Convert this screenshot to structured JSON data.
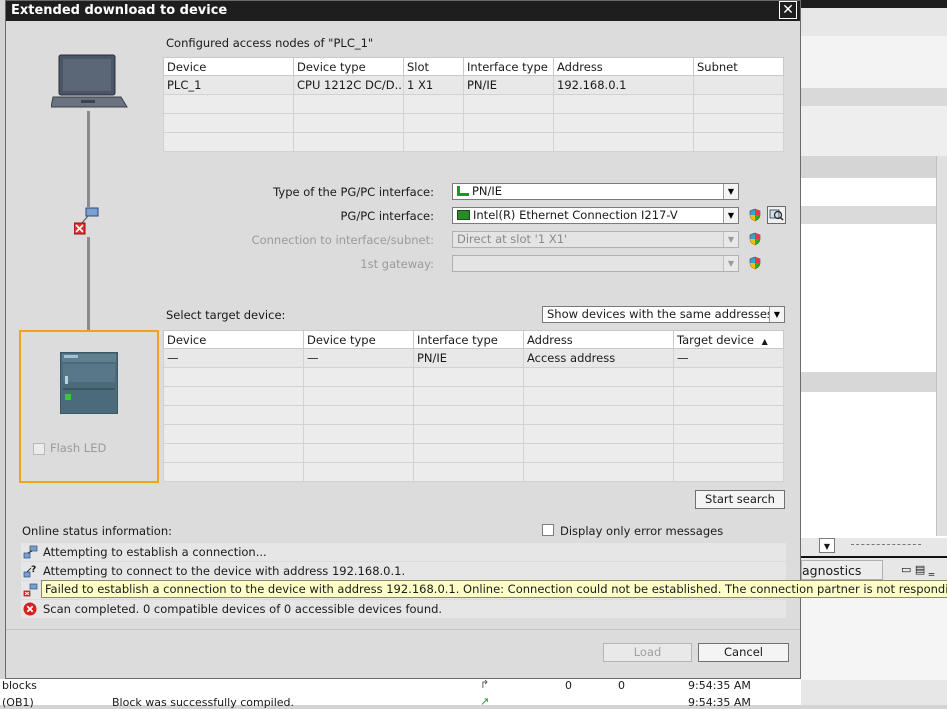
{
  "dialog": {
    "title": "Extended download to device",
    "close_glyph": "✕"
  },
  "configured": {
    "heading": "Configured access nodes of \"PLC_1\"",
    "columns": [
      "Device",
      "Device type",
      "Slot",
      "Interface type",
      "Address",
      "Subnet"
    ],
    "rows": [
      [
        "PLC_1",
        "CPU 1212C DC/D...",
        "1 X1",
        "PN/IE",
        "192.168.0.1",
        ""
      ]
    ]
  },
  "interface": {
    "type_label": "Type of the PG/PC interface:",
    "type_value": "PN/IE",
    "pgpc_label": "PG/PC interface:",
    "pgpc_value": "Intel(R) Ethernet Connection I217-V",
    "subnet_label": "Connection to interface/subnet:",
    "subnet_value": "Direct at slot '1 X1'",
    "gateway_label": "1st gateway:",
    "gateway_value": ""
  },
  "target": {
    "heading": "Select target device:",
    "filter_value": "Show devices with the same addresses",
    "columns": [
      "Device",
      "Device type",
      "Interface type",
      "Address",
      "Target device"
    ],
    "rows": [
      [
        "—",
        "—",
        "PN/IE",
        "Access address",
        "—"
      ]
    ],
    "sort_glyph": "▲"
  },
  "left_panel": {
    "flash_led_label": "Flash LED"
  },
  "buttons": {
    "start_search": "Start search",
    "load": "Load",
    "cancel": "Cancel"
  },
  "status": {
    "heading": "Online status information:",
    "error_only_label": "Display only error messages",
    "messages": [
      "Attempting to establish a connection...",
      "Attempting to connect to the device with address 192.168.0.1.",
      "Failed to establish a connection to the device with address 192.168.0.1. Online: Connection could not be established. The connection partner is not responding.",
      "Scan completed. 0 compatible devices of 0 accessible devices found."
    ]
  },
  "background": {
    "diagnostics_tab": "agnostics",
    "bottom_row1": {
      "name": "blocks",
      "n1": "0",
      "n2": "0",
      "time": "9:54:35 AM"
    },
    "bottom_row2": {
      "name": "(OB1)",
      "text": "Block was successfully compiled.",
      "time": "9:54:35 AM"
    }
  },
  "colors": {
    "panel_highlight": "#f2a11e",
    "error_red": "#d42020",
    "tooltip_bg": "#ffffc8",
    "title_bg": "#1e1e1e"
  }
}
